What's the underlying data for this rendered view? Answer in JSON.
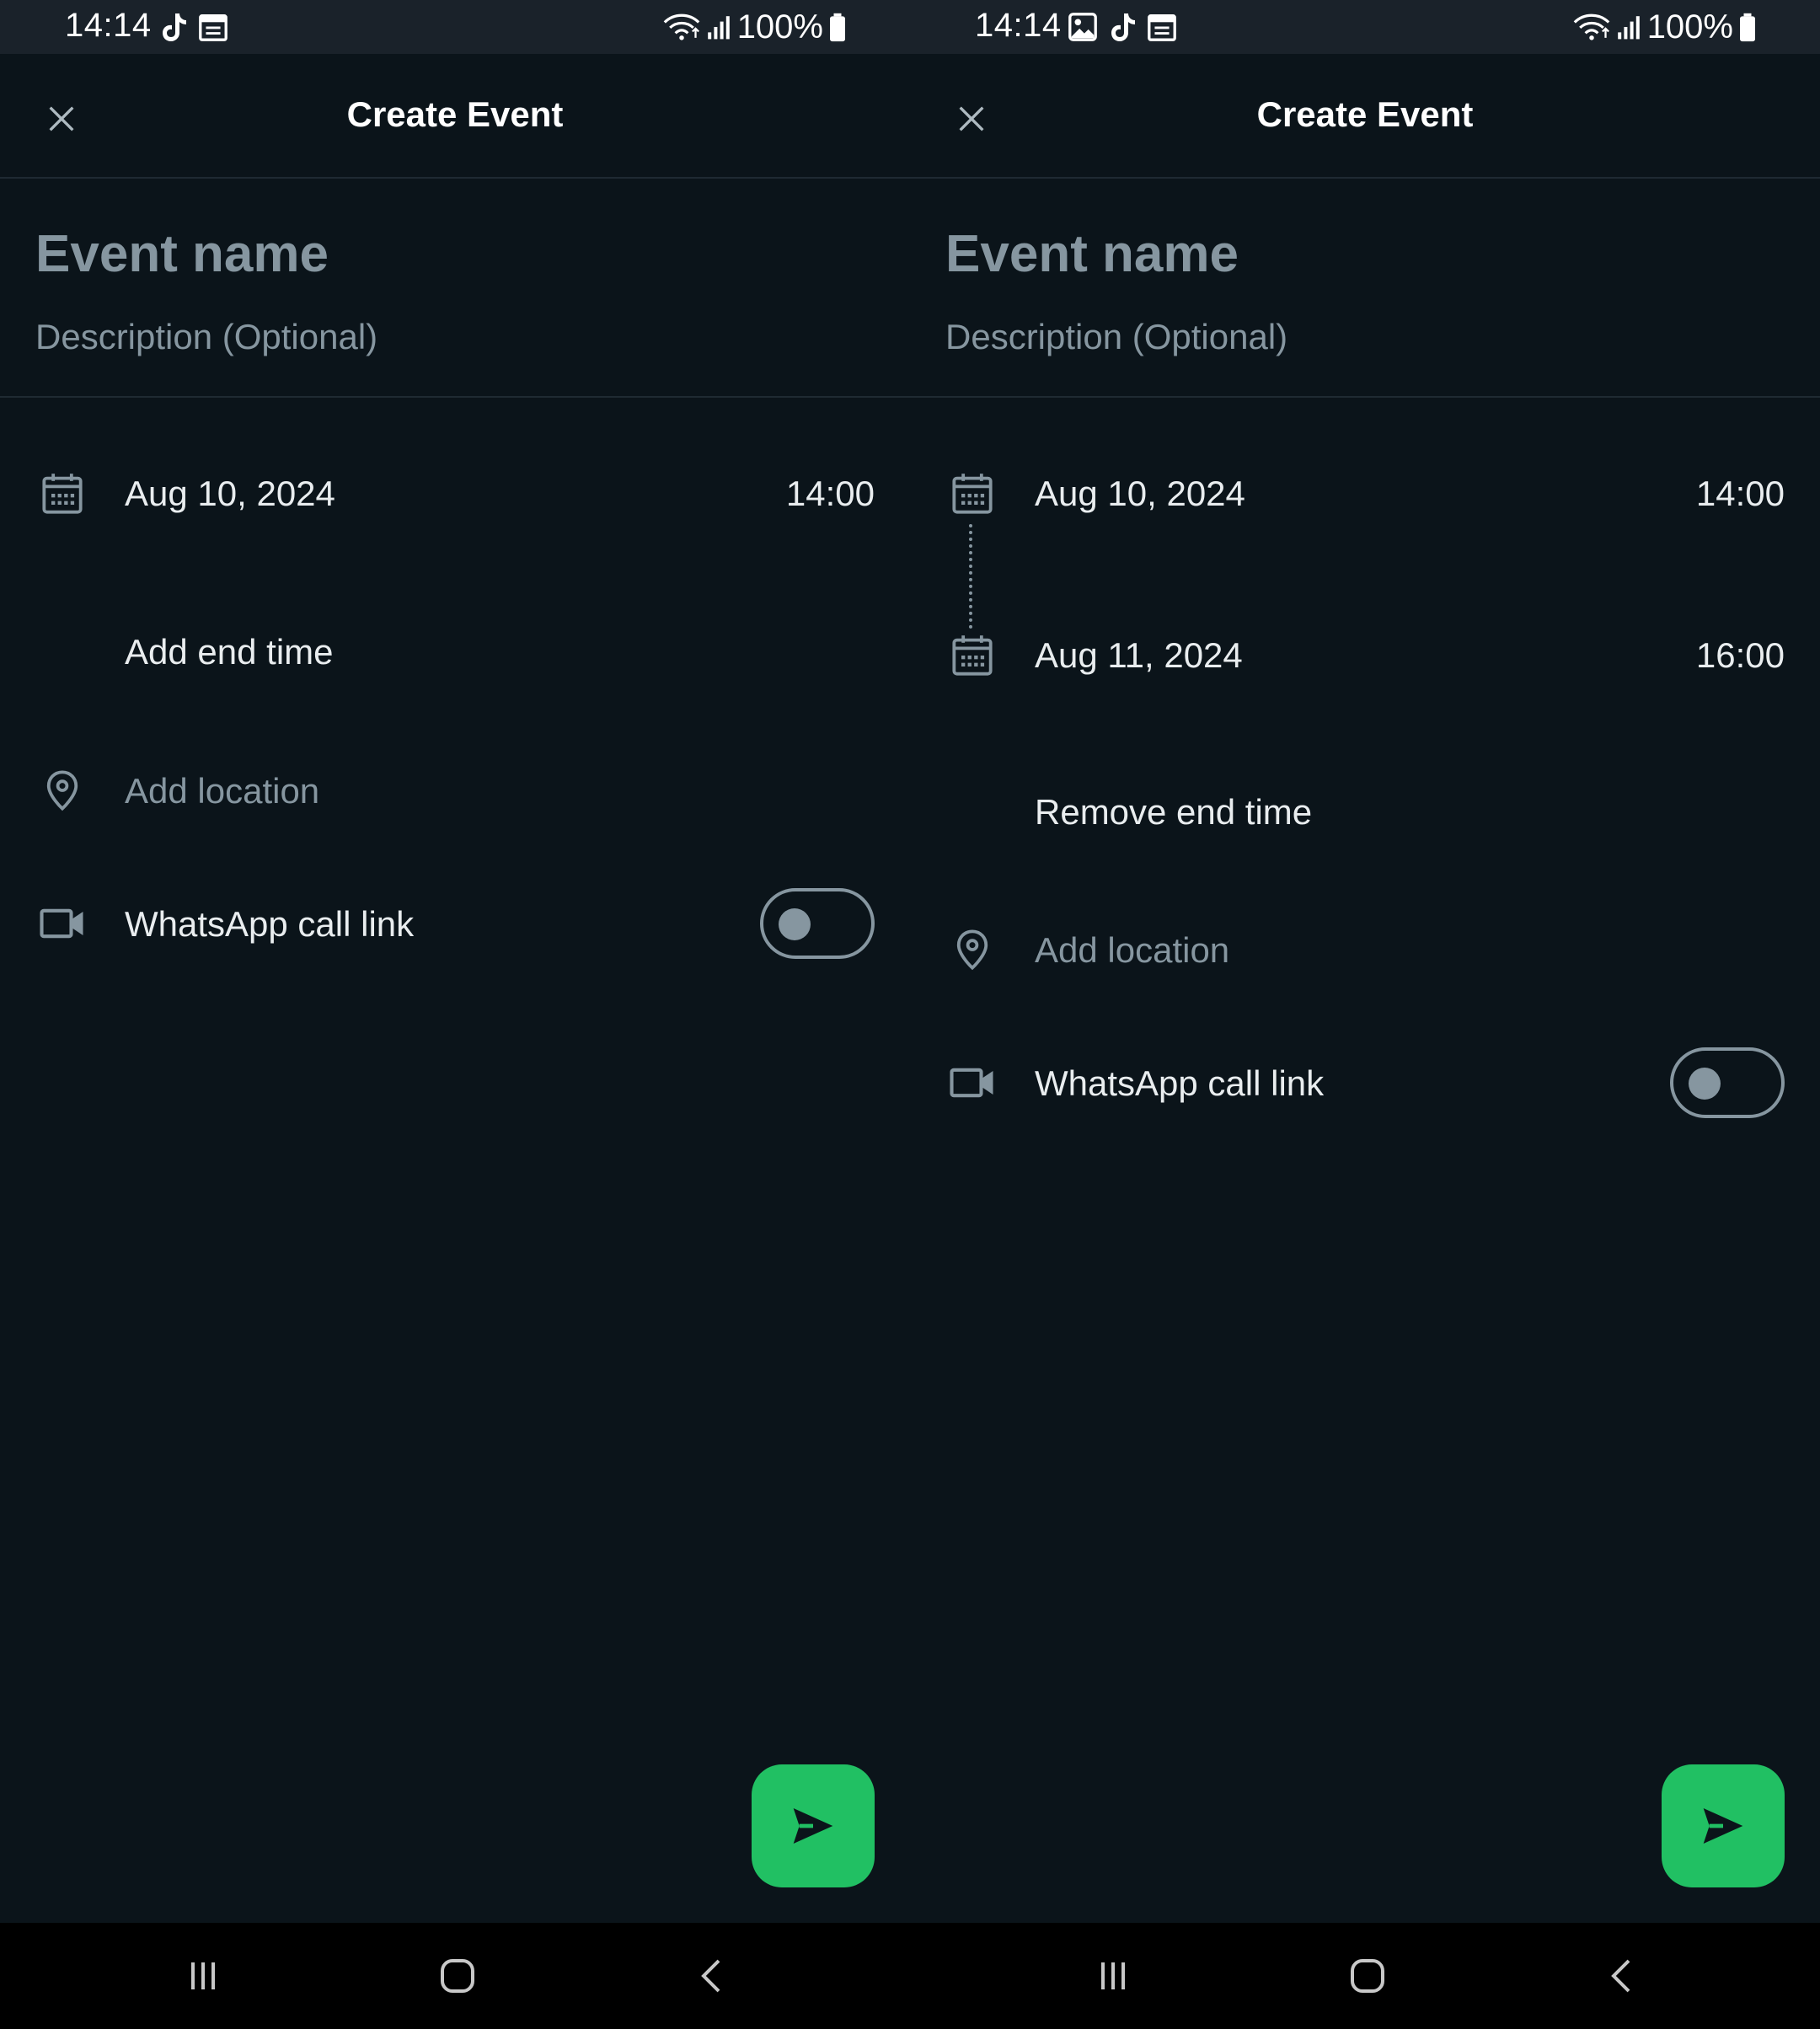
{
  "colors": {
    "background": "#0b141a",
    "status_bar": "#1a222a",
    "text_primary": "#e9edef",
    "text_muted": "#8696a0",
    "accent": "#21c063",
    "nav_bar": "#000000"
  },
  "screens": [
    {
      "status": {
        "time": "14:14",
        "battery": "100%",
        "notification_icons": [
          "tiktok-icon",
          "calendar-icon"
        ]
      },
      "app_bar": {
        "title": "Create Event",
        "close_icon": "close-icon"
      },
      "form": {
        "event_name_placeholder": "Event name",
        "description_placeholder": "Description (Optional)",
        "start_date": "Aug 10, 2024",
        "start_time": "14:00",
        "end_time_action": "Add end time",
        "location_placeholder": "Add location",
        "call_link_label": "WhatsApp call link",
        "call_link_enabled": false
      },
      "send_icon": "send-icon"
    },
    {
      "status": {
        "time": "14:14",
        "battery": "100%",
        "notification_icons": [
          "gallery-icon",
          "tiktok-icon",
          "calendar-icon"
        ]
      },
      "app_bar": {
        "title": "Create Event",
        "close_icon": "close-icon"
      },
      "form": {
        "event_name_placeholder": "Event name",
        "description_placeholder": "Description (Optional)",
        "start_date": "Aug 10, 2024",
        "start_time": "14:00",
        "end_date": "Aug 11, 2024",
        "end_time": "16:00",
        "end_time_action": "Remove end time",
        "location_placeholder": "Add location",
        "call_link_label": "WhatsApp call link",
        "call_link_enabled": false
      },
      "send_icon": "send-icon"
    }
  ],
  "nav": {
    "icons": [
      "recents-icon",
      "home-icon",
      "back-icon"
    ]
  }
}
